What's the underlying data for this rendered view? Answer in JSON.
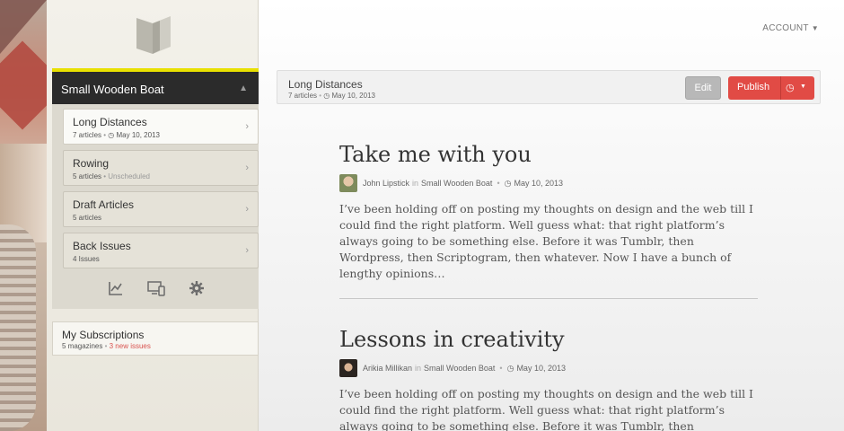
{
  "sidebar": {
    "publication": "Small Wooden Boat",
    "issues": [
      {
        "name": "Long Distances",
        "articles": "7 articles",
        "date": "May 10, 2013"
      },
      {
        "name": "Rowing",
        "articles": "5 articles",
        "date": "Unscheduled"
      },
      {
        "name": "Draft Articles",
        "articles": "5 articles",
        "date": ""
      },
      {
        "name": "Back Issues",
        "articles": "4 Issues",
        "date": ""
      }
    ],
    "tools": [
      "stats-icon",
      "devices-icon",
      "gear-icon"
    ],
    "subscriptions": {
      "name": "My Subscriptions",
      "count": "5 magazines",
      "new": "3 new issues"
    }
  },
  "header": {
    "account": "ACCOUNT"
  },
  "issuebar": {
    "name": "Long Distances",
    "articles": "7 articles",
    "date": "May 10, 2013",
    "edit": "Edit",
    "publish": "Publish"
  },
  "articles": [
    {
      "title": "Take me with you",
      "author": "John Lipstick",
      "in": "in",
      "publication": "Small Wooden Boat",
      "date": "May 10, 2013",
      "excerpt": "I’ve been holding off on posting my thoughts on design and the web till I could find the right platform. Well guess what: that right platform’s always going to be something else. Before it was Tumblr, then Wordpress, then Scriptogram, then whatever. Now I have a bunch of lengthy opinions…"
    },
    {
      "title": "Lessons in creativity",
      "author": "Arikia Millikan",
      "in": "in",
      "publication": "Small Wooden Boat",
      "date": "May 10, 2013",
      "excerpt": "I’ve been holding off on posting my thoughts on design and the web till I could find the right platform. Well guess what: that right platform’s always going to be something else. Before it was Tumblr, then Wordpress, then"
    }
  ],
  "colors": {
    "accent_yellow": "#e8e000",
    "publish_red": "#e14b45",
    "new_issues_red": "#d9534f"
  }
}
